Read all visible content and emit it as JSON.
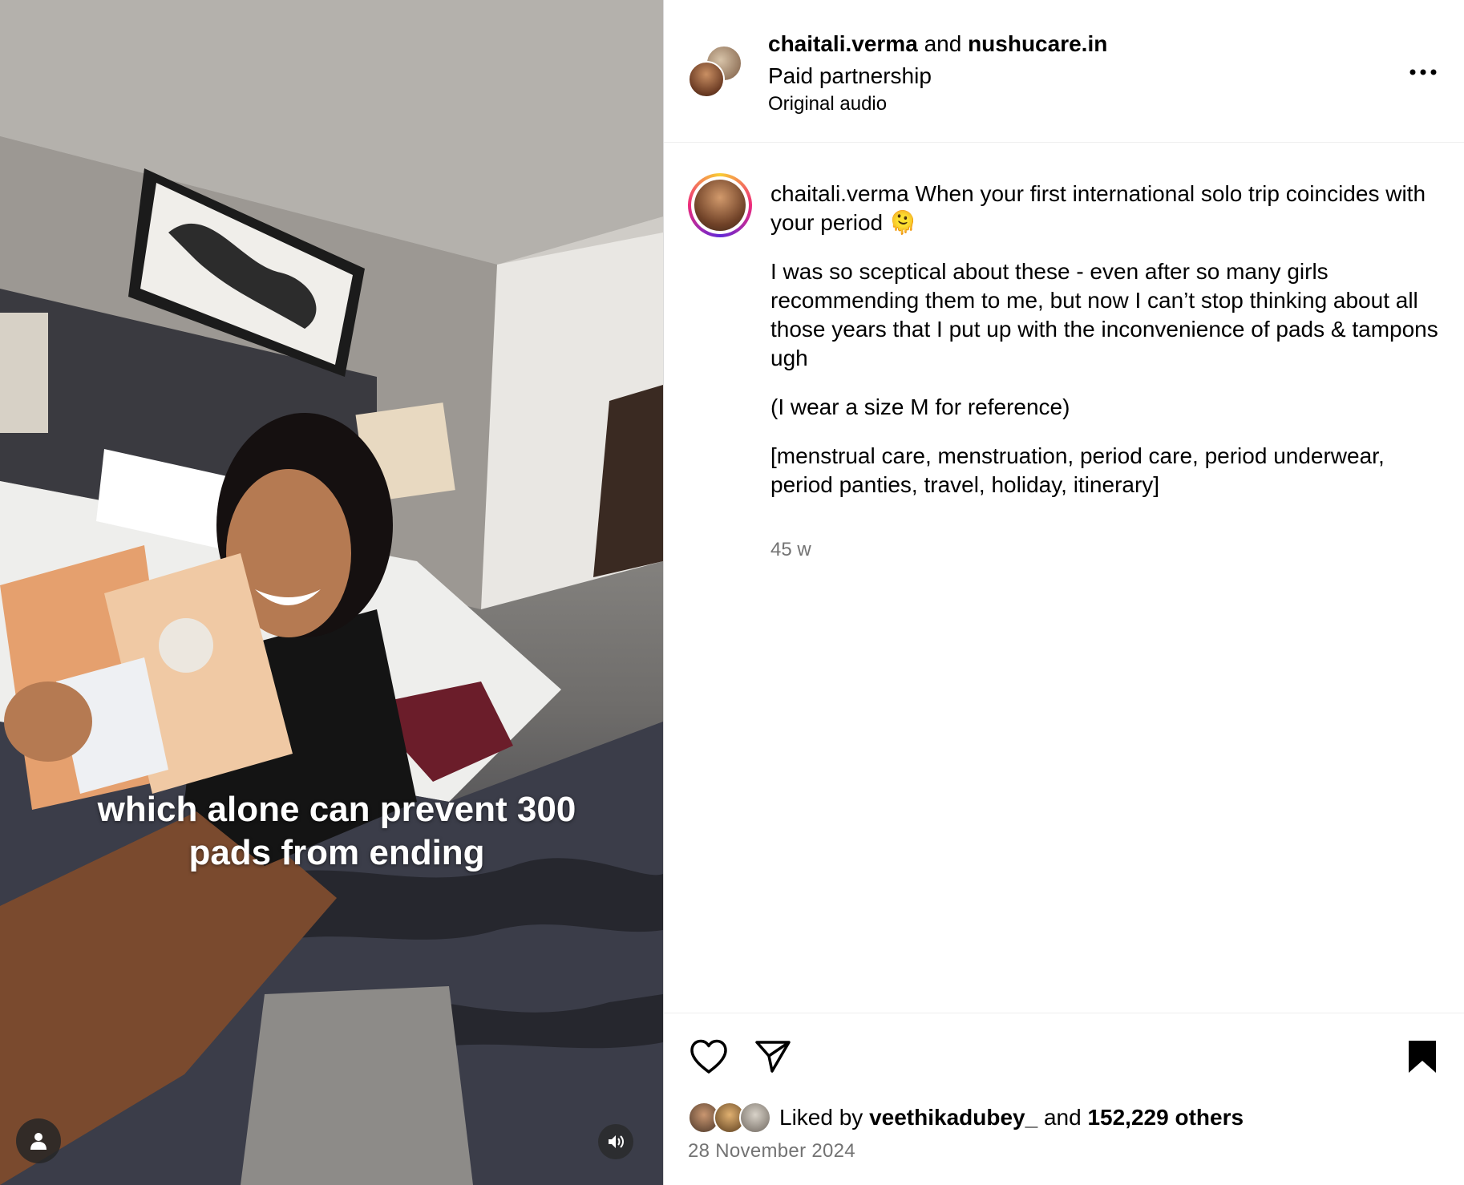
{
  "video": {
    "caption_line1": "which alone can prevent 300",
    "caption_line2": "pads from ending",
    "icons": [
      "user-icon",
      "speaker-icon"
    ]
  },
  "header": {
    "user": "chaitali.verma",
    "joiner": "and",
    "partner": "nushucare.in",
    "label": "Paid partnership",
    "audio": "Original audio",
    "more_icon": "more-horizontal-icon"
  },
  "post": {
    "username": "chaitali.verma",
    "first_line": "When your first international solo trip coincides with your period 🫠",
    "paragraph2": "I was so sceptical about these - even after so many girls recommending them to me, but now I can’t stop thinking about all those years that I put up with the inconvenience of pads & tampons ugh",
    "paragraph3": "(I wear a size M for reference)",
    "paragraph4": "[menstrual care, menstruation, period care, period underwear, period panties, travel, holiday, itinerary]",
    "time": "45 w"
  },
  "actions": {
    "like_icon": "heart-icon",
    "share_icon": "paper-plane-icon",
    "save_icon": "bookmark-icon",
    "liked_prefix": "Liked by",
    "liked_user": "veethikadubey_",
    "liked_joiner": "and",
    "liked_others": "152,229 others",
    "date": "28 November 2024"
  }
}
